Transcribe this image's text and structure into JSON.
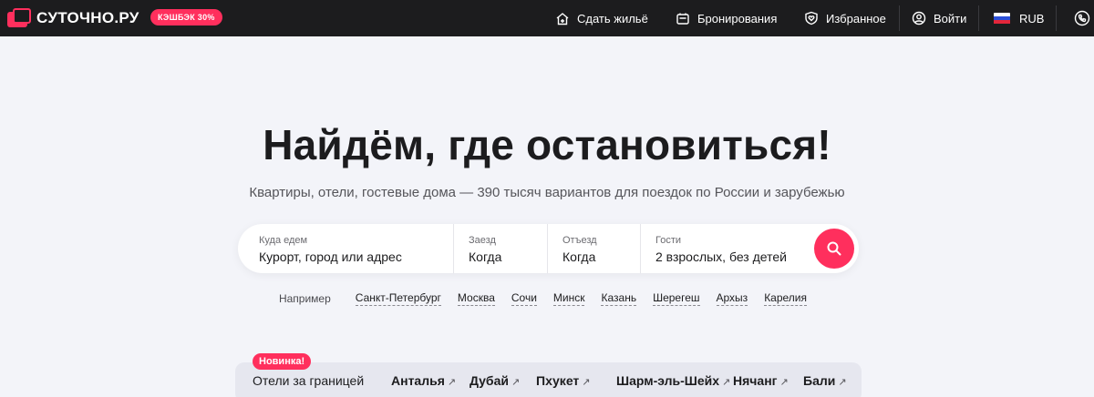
{
  "header": {
    "logo_text": "СУТОЧНО.РУ",
    "cashback_badge": "КЭШБЭК 30%",
    "nav": {
      "rent_out": "Сдать жильё",
      "bookings": "Бронирования",
      "favorites": "Избранное",
      "login": "Войти",
      "currency": "RUB"
    }
  },
  "hero": {
    "title": "Найдём, где остановиться!",
    "subtitle": "Квартиры, отели, гостевые дома — 390 тысяч вариантов для поездок по России и зарубежью"
  },
  "search": {
    "where_label": "Куда едем",
    "where_value": "Курорт, город или адрес",
    "checkin_label": "Заезд",
    "checkin_value": "Когда",
    "checkout_label": "Отъезд",
    "checkout_value": "Когда",
    "guests_label": "Гости",
    "guests_value": "2 взрослых, без детей"
  },
  "examples": {
    "label": "Например",
    "items": [
      "Санкт-Петербург",
      "Москва",
      "Сочи",
      "Минск",
      "Казань",
      "Шерегеш",
      "Архыз",
      "Карелия"
    ]
  },
  "abroad": {
    "badge": "Новинка!",
    "label": "Отели за границей",
    "destinations": [
      "Анталья",
      "Дубай",
      "Пхукет",
      "Шарм-эль-Шейх",
      "Нячанг",
      "Бали"
    ],
    "arrow": "↗"
  },
  "colors": {
    "accent": "#ff2f5d",
    "topbar": "#1c1c1e",
    "background": "#f3f4f9"
  }
}
